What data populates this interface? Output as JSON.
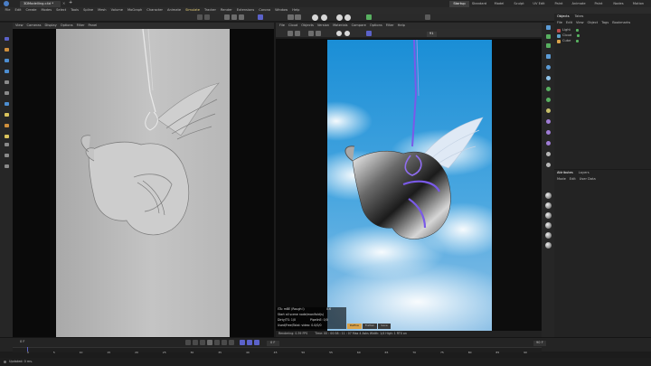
{
  "app": {
    "doc_tab": "3DModelling.c4d *",
    "add_tab": "+",
    "layouts": [
      "Startup",
      "Standard",
      "Model",
      "Sculpt",
      "UV Edit",
      "Paint",
      "Animate",
      "Paint",
      "Nodes",
      "Motion"
    ],
    "active_layout": "Startup"
  },
  "menubar": [
    "File",
    "Edit",
    "Create",
    "Modes",
    "Select",
    "Tools",
    "Spline",
    "Mesh",
    "Volume",
    "MoGraph",
    "Character",
    "Animate",
    "Simulate",
    "Tracker",
    "Render",
    "Extensions",
    "Corona",
    "Window",
    "Help"
  ],
  "left_viewport": {
    "menu": [
      "View",
      "Cameras",
      "Display",
      "Options",
      "Filter",
      "Panel"
    ]
  },
  "picture_viewer": {
    "menu": [
      "File",
      "Cloud",
      "Objects",
      "Version",
      "Materials",
      "Compare",
      "Options",
      "Filter",
      "Help"
    ],
    "status_text": "Render Finished",
    "zoom_value": "91",
    "info_rows": [
      {
        "label": "ITA: mBE (Rough l)",
        "value": "0.6"
      },
      {
        "label": "Start all scene node/manifold(s)",
        "value": ""
      },
      {
        "label": "Dirty/TS: 1/0",
        "value": "PipelinE: 0/0"
      },
      {
        "label": "Used/Free/Total: video: 0.0/0/0",
        "value": ""
      }
    ],
    "render_tabs": [
      "Define",
      "Flatten",
      "Save"
    ],
    "bottom_left": "Rendering: 0.39 FPS",
    "bottom_stats": "Time: 00 : 00:58 : 11 : 07   Max 4 Asks  Width: 1/4   High: 1   RTX on"
  },
  "objects_panel": {
    "tabs": [
      "Objects",
      "Takes"
    ],
    "menu": [
      "File",
      "Edit",
      "View",
      "Object",
      "Tags",
      "Bookmarks"
    ],
    "items": [
      {
        "name": "Light",
        "color": "#b84a4a"
      },
      {
        "name": "Cloud",
        "color": "#5fa0c8"
      },
      {
        "name": "Cube",
        "color": "#d9a24a"
      }
    ]
  },
  "attributes_panel": {
    "tabs": [
      "Attributes",
      "Layers"
    ],
    "menu": [
      "Mode",
      "Edit",
      "User Data"
    ]
  },
  "timeline": {
    "current_frame": "0 F",
    "start_frame": "0 F",
    "end_frame": "90 F",
    "ticks": [
      "0",
      "5",
      "10",
      "15",
      "20",
      "25",
      "30",
      "35",
      "40",
      "45",
      "50",
      "55",
      "60",
      "65",
      "70",
      "75",
      "80",
      "85",
      "90"
    ]
  },
  "statusbar": {
    "text": "Updated: 0 ms."
  },
  "colors": {
    "accent": "#5b62c9",
    "sky_top": "#1a8ed6",
    "sky_bottom": "#8fc1e6",
    "viewport_bg": "#b8b8b8",
    "rope": "#7a5ae8"
  },
  "icons": {
    "toolbar": [
      "undo-icon",
      "redo-icon",
      "move-icon",
      "scale-icon",
      "rotate-icon",
      "select-icon",
      "render-icon",
      "render-view-icon",
      "cube-icon",
      "pen-icon",
      "sphere-icon"
    ],
    "left_palette": [
      "select-icon",
      "move-icon",
      "scale-icon",
      "rotate-icon",
      "live-select-icon",
      "box-icon",
      "loop-icon",
      "knife-icon",
      "brush-icon",
      "magnet-icon",
      "spline-pen-icon",
      "sculpt-icon",
      "uv-icon"
    ],
    "right_palette": [
      "cube-icon",
      "spline-icon",
      "generator-icon",
      "deformer-icon",
      "camera-icon",
      "light-icon",
      "plus-icon",
      "field-icon",
      "mograph-icon",
      "effector-icon",
      "material-icon",
      "tag-icon",
      "hair-icon",
      "cloner-icon"
    ]
  }
}
